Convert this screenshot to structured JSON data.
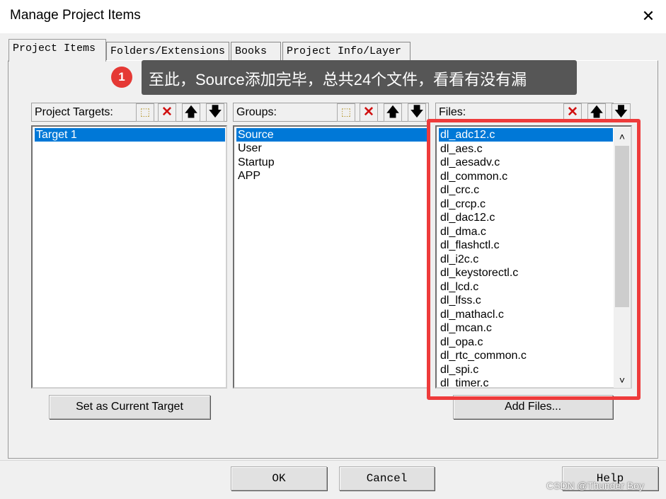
{
  "window": {
    "title": "Manage Project Items",
    "close_glyph": "✕"
  },
  "tabs": [
    {
      "label": "Project Items",
      "active": true
    },
    {
      "label": "Folders/Extensions",
      "active": false
    },
    {
      "label": "Books",
      "active": false
    },
    {
      "label": "Project Info/Layer",
      "active": false
    }
  ],
  "annotation": {
    "number": "1",
    "text": "至此，Source添加完毕，总共24个文件，看看有没有漏",
    "highlight_color": "#ee3b3b"
  },
  "targets": {
    "label": "Project Targets:",
    "items": [
      "Target 1"
    ],
    "selected": "Target 1",
    "button": "Set as Current Target"
  },
  "groups": {
    "label": "Groups:",
    "items": [
      "Source",
      "User",
      "Startup",
      "APP"
    ],
    "selected": "Source"
  },
  "files": {
    "label": "Files:",
    "items": [
      "dl_adc12.c",
      "dl_aes.c",
      "dl_aesadv.c",
      "dl_common.c",
      "dl_crc.c",
      "dl_crcp.c",
      "dl_dac12.c",
      "dl_dma.c",
      "dl_flashctl.c",
      "dl_i2c.c",
      "dl_keystorectl.c",
      "dl_lcd.c",
      "dl_lfss.c",
      "dl_mathacl.c",
      "dl_mcan.c",
      "dl_opa.c",
      "dl_rtc_common.c",
      "dl_spi.c",
      "dl_timer.c"
    ],
    "selected": "dl_adc12.c",
    "button": "Add Files..."
  },
  "toolbar_icons": {
    "new": "new-item-icon",
    "delete": "delete-icon",
    "up": "move-up-icon",
    "down": "move-down-icon"
  },
  "glyphs": {
    "new": "⬚",
    "delete": "✕",
    "up": "🡅",
    "down": "🡇",
    "scroll_up": "˄",
    "scroll_down": "˅"
  },
  "footer": {
    "ok": "OK",
    "cancel": "Cancel",
    "help": "Help"
  },
  "watermark": "CSDN @Thunder Boy",
  "colors": {
    "selection": "#0078d7",
    "callout_bg": "#565656",
    "badge": "#e53935"
  }
}
